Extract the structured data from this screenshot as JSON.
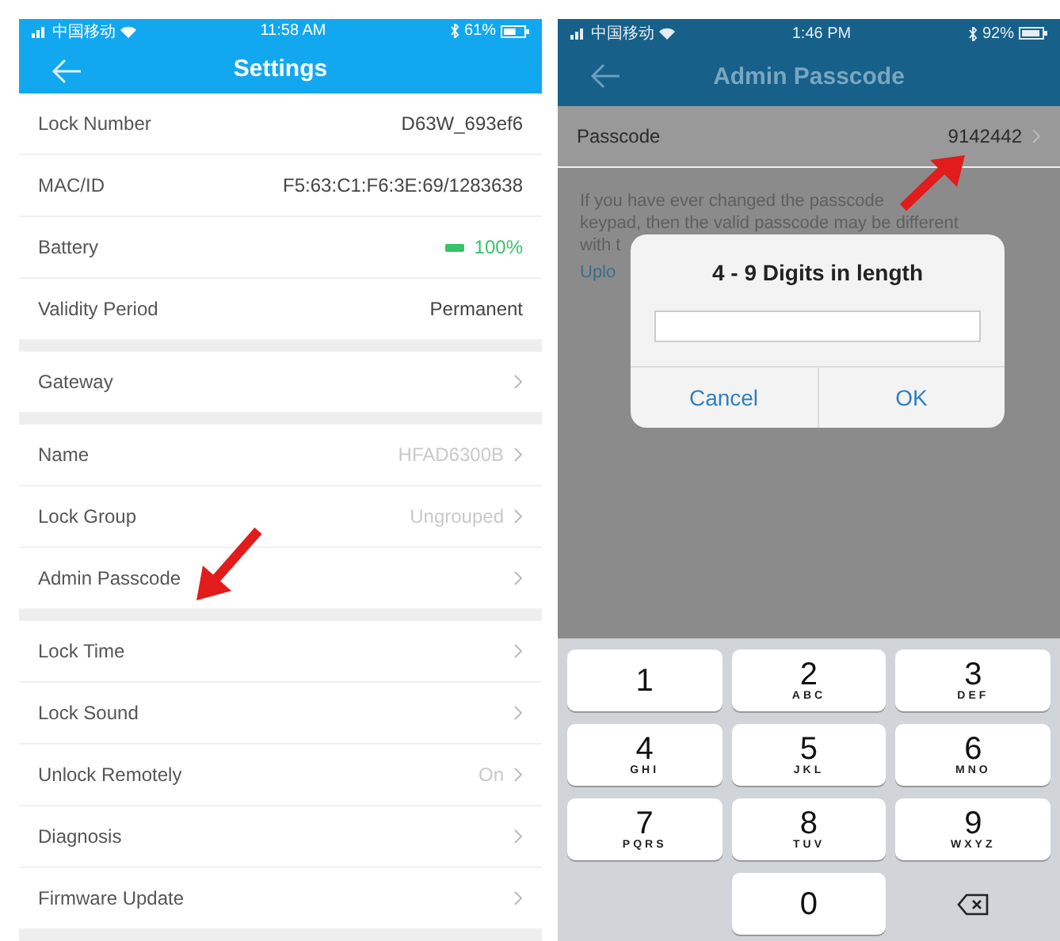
{
  "settings_screen": {
    "status_bar": {
      "carrier": "中国移动",
      "time": "11:58 AM",
      "battery": "61%"
    },
    "title": "Settings",
    "sections": [
      {
        "rows": [
          {
            "kind": "info",
            "label": "Lock Number",
            "value": "D63W_693ef6"
          },
          {
            "kind": "info",
            "label": "MAC/ID",
            "value": "F5:63:C1:F6:3E:69/1283638"
          },
          {
            "kind": "battery",
            "label": "Battery",
            "value": "100%"
          },
          {
            "kind": "info",
            "label": "Validity Period",
            "value": "Permanent"
          }
        ]
      },
      {
        "rows": [
          {
            "kind": "link",
            "label": "Gateway"
          }
        ]
      },
      {
        "rows": [
          {
            "kind": "link",
            "label": "Name",
            "value": "HFAD6300B"
          },
          {
            "kind": "link",
            "label": "Lock Group",
            "value": "Ungrouped"
          },
          {
            "kind": "link",
            "label": "Admin Passcode"
          }
        ]
      },
      {
        "rows": [
          {
            "kind": "link",
            "label": "Lock Time"
          },
          {
            "kind": "link",
            "label": "Lock Sound"
          },
          {
            "kind": "link",
            "label": "Unlock Remotely",
            "value": "On"
          },
          {
            "kind": "link",
            "label": "Diagnosis"
          },
          {
            "kind": "link",
            "label": "Firmware Update"
          }
        ]
      }
    ]
  },
  "admin_passcode_screen": {
    "status_bar": {
      "carrier": "中国移动",
      "time": "1:46 PM",
      "battery": "92%"
    },
    "title": "Admin Passcode",
    "passcode_row": {
      "label": "Passcode",
      "value": "9142442"
    },
    "note_lines": [
      "If you have ever changed the passcode",
      "keypad, then the valid passcode may be different",
      "with t"
    ],
    "link": "Uplo",
    "dialog": {
      "title": "4 - 9 Digits in length",
      "buttons": [
        "Cancel",
        "OK"
      ]
    },
    "keypad": [
      {
        "kind": "digit",
        "digit": "1"
      },
      {
        "kind": "digit",
        "digit": "2",
        "letters": "ABC"
      },
      {
        "kind": "digit",
        "digit": "3",
        "letters": "DEF"
      },
      {
        "kind": "digit",
        "digit": "4",
        "letters": "GHI"
      },
      {
        "kind": "digit",
        "digit": "5",
        "letters": "JKL"
      },
      {
        "kind": "digit",
        "digit": "6",
        "letters": "MNO"
      },
      {
        "kind": "digit",
        "digit": "7",
        "letters": "PQRS"
      },
      {
        "kind": "digit",
        "digit": "8",
        "letters": "TUV"
      },
      {
        "kind": "digit",
        "digit": "9",
        "letters": "WXYZ"
      },
      {
        "kind": "blank"
      },
      {
        "kind": "digit",
        "digit": "0"
      },
      {
        "kind": "backspace"
      }
    ]
  }
}
